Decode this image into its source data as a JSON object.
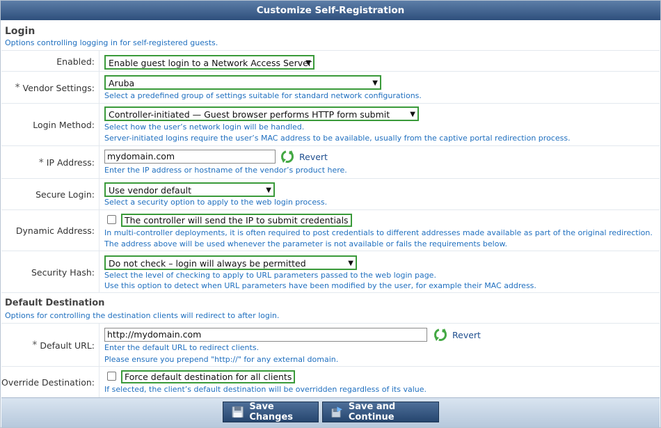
{
  "window": {
    "title": "Customize Self-Registration"
  },
  "login": {
    "title": "Login",
    "description": "Options controlling logging in for self-registered guests.",
    "enabled": {
      "label": "Enabled:",
      "value": "Enable guest login to a Network Access Server"
    },
    "vendor": {
      "label": "Vendor Settings:",
      "value": "Aruba",
      "help": "Select a predefined group of settings suitable for standard network configurations."
    },
    "login_method": {
      "label": "Login Method:",
      "value": "Controller-initiated — Guest browser performs HTTP form submit",
      "help1": "Select how the user’s network login will be handled.",
      "help2": "Server-initiated logins require the user’s MAC address to be available, usually from the captive portal redirection process."
    },
    "ip_address": {
      "label": "IP Address:",
      "value": "mydomain.com",
      "revert": "Revert",
      "help": "Enter the IP address or hostname of the vendor’s product here."
    },
    "secure_login": {
      "label": "Secure Login:",
      "value": "Use vendor default",
      "help": "Select a security option to apply to the web login process."
    },
    "dynamic_address": {
      "label": "Dynamic Address:",
      "checkbox_label": "The controller will send the IP to submit credentials",
      "help1": "In multi-controller deployments, it is often required to post credentials to different addresses made available as part of the original redirection.",
      "help2": "The address above will be used whenever the parameter is not available or fails the requirements below."
    },
    "security_hash": {
      "label": "Security Hash:",
      "value": "Do not check – login will always be permitted",
      "help1": "Select the level of checking to apply to URL parameters passed to the web login page.",
      "help2": "Use this option to detect when URL parameters have been modified by the user, for example their MAC address."
    }
  },
  "destination": {
    "title": "Default Destination",
    "description": "Options for controlling the destination clients will redirect to after login.",
    "default_url": {
      "label": "Default URL:",
      "value": "http://mydomain.com",
      "revert": "Revert",
      "help1": "Enter the default URL to redirect clients.",
      "help2": "Please ensure you prepend \"http://\" for any external domain."
    },
    "override": {
      "label": "Override Destination:",
      "checkbox_label": "Force default destination for all clients",
      "help": "If selected, the client’s default destination will be overridden regardless of its value."
    }
  },
  "required_marker": "*",
  "footer": {
    "save": "Save Changes",
    "save_continue": "Save and Continue"
  },
  "colors": {
    "accent": "#2e4f7c",
    "help_text": "#1f6fbf",
    "highlight": "#3a9a3a"
  }
}
